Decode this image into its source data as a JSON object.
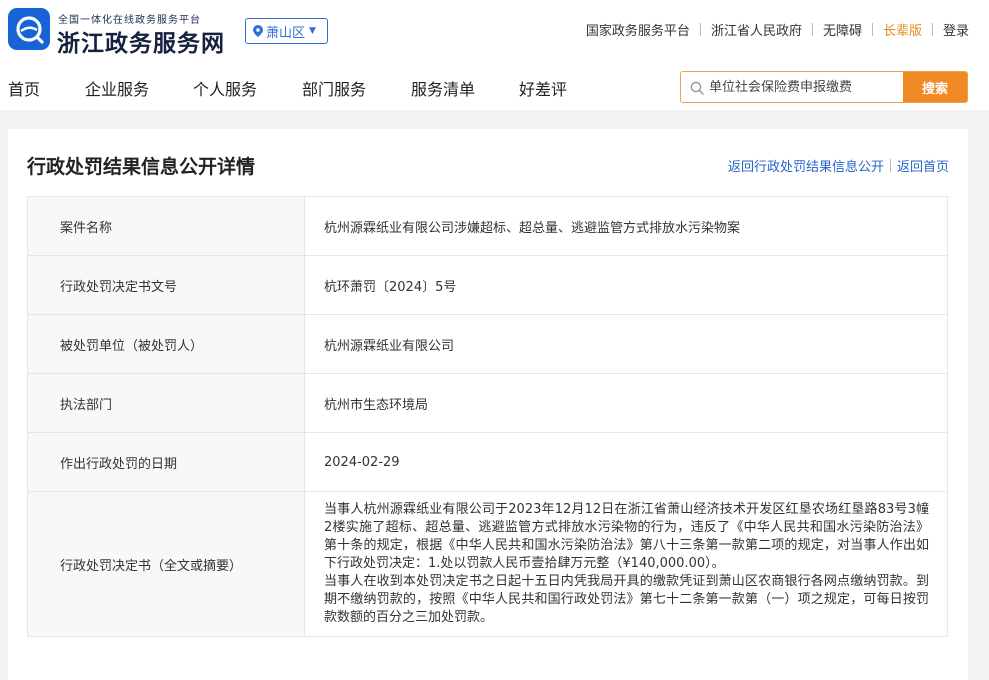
{
  "header": {
    "platform_tagline": "全国一体化在线政务服务平台",
    "site_name": "浙江政务服务网",
    "region": "萧山区",
    "top_links": [
      "国家政务服务平台",
      "浙江省人民政府",
      "无障碍",
      "长辈版",
      "登录"
    ],
    "highlight_color": "#e6891e"
  },
  "nav": {
    "items": [
      "首页",
      "企业服务",
      "个人服务",
      "部门服务",
      "服务清单",
      "好差评"
    ]
  },
  "search": {
    "placeholder": "单位社会保险费申报缴费",
    "button_label": "搜索",
    "button_color": "#f08a24"
  },
  "page": {
    "title": "行政处罚结果信息公开详情",
    "links": [
      "返回行政处罚结果信息公开",
      "返回首页"
    ]
  },
  "detail_rows": [
    {
      "label": "案件名称",
      "value": "杭州源霖纸业有限公司涉嫌超标、超总量、逃避监管方式排放水污染物案"
    },
    {
      "label": "行政处罚决定书文号",
      "value": "杭环萧罚〔2024〕5号"
    },
    {
      "label": "被处罚单位（被处罚人）",
      "value": "杭州源霖纸业有限公司"
    },
    {
      "label": "执法部门",
      "value": "杭州市生态环境局"
    },
    {
      "label": "作出行政处罚的日期",
      "value": "2024-02-29"
    },
    {
      "label": "行政处罚决定书（全文或摘要）",
      "value": "当事人杭州源霖纸业有限公司于2023年12月12日在浙江省萧山经济技术开发区红垦农场红垦路83号3幢2楼实施了超标、超总量、逃避监管方式排放水污染物的行为，违反了《中华人民共和国水污染防治法》第十条的规定，根据《中华人民共和国水污染防治法》第八十三条第一款第二项的规定，对当事人作出如下行政处罚决定：1.处以罚款人民币壹拾肆万元整（¥140,000.00）。\n当事人在收到本处罚决定书之日起十五日内凭我局开具的缴款凭证到萧山区农商银行各网点缴纳罚款。到期不缴纳罚款的，按照《中华人民共和国行政处罚法》第七十二条第一款第（一）项之规定，可每日按罚款数额的百分之三加处罚款。"
    }
  ],
  "icons": {
    "logo": "zhejiang-logo-icon",
    "region": "location-pin-icon",
    "search": "search-icon"
  }
}
